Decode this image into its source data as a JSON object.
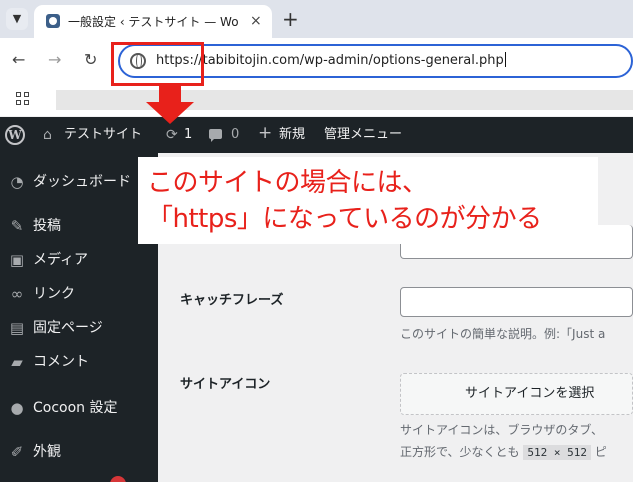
{
  "browser": {
    "tab_title": "一般設定 ‹ テストサイト — WordPress",
    "tab_close": "×",
    "new_tab": "+",
    "back": "←",
    "forward": "→",
    "reload": "↻",
    "url": "https://tabibitojin.com/wp-admin/options-general.php",
    "accent": "#2c63d6"
  },
  "adminbar": {
    "site_name": "テストサイト",
    "updates_count": "1",
    "comments_count": "0",
    "new_label": "新規",
    "admin_menu_label": "管理メニュー"
  },
  "sidebar": {
    "items": [
      {
        "label": "ダッシュボード",
        "icon": "dashboard-icon"
      },
      {
        "label": "投稿",
        "icon": "pin-icon"
      },
      {
        "label": "メディア",
        "icon": "media-icon"
      },
      {
        "label": "リンク",
        "icon": "link-icon"
      },
      {
        "label": "固定ページ",
        "icon": "page-icon"
      },
      {
        "label": "コメント",
        "icon": "comment-icon"
      },
      {
        "label": "Cocoon 設定",
        "icon": "cocoon-icon"
      },
      {
        "label": "外観",
        "icon": "brush-icon"
      }
    ]
  },
  "settings": {
    "tagline_label": "キャッチフレーズ",
    "tagline_value": "",
    "tagline_desc": "このサイトの簡単な説明。例:「Just a",
    "site_icon_label": "サイトアイコン",
    "site_icon_button": "サイトアイコンを選択",
    "site_icon_desc_1": "サイトアイコンは、ブラウザのタブ、",
    "site_icon_desc_2_pre": "正方形で、少なくとも",
    "site_icon_size": "512 × 512",
    "site_icon_desc_2_post": "ピ"
  },
  "annotation": {
    "line1": "このサイトの場合には、",
    "line2": "「https」になっているのが分かる",
    "color": "#e8211b"
  }
}
